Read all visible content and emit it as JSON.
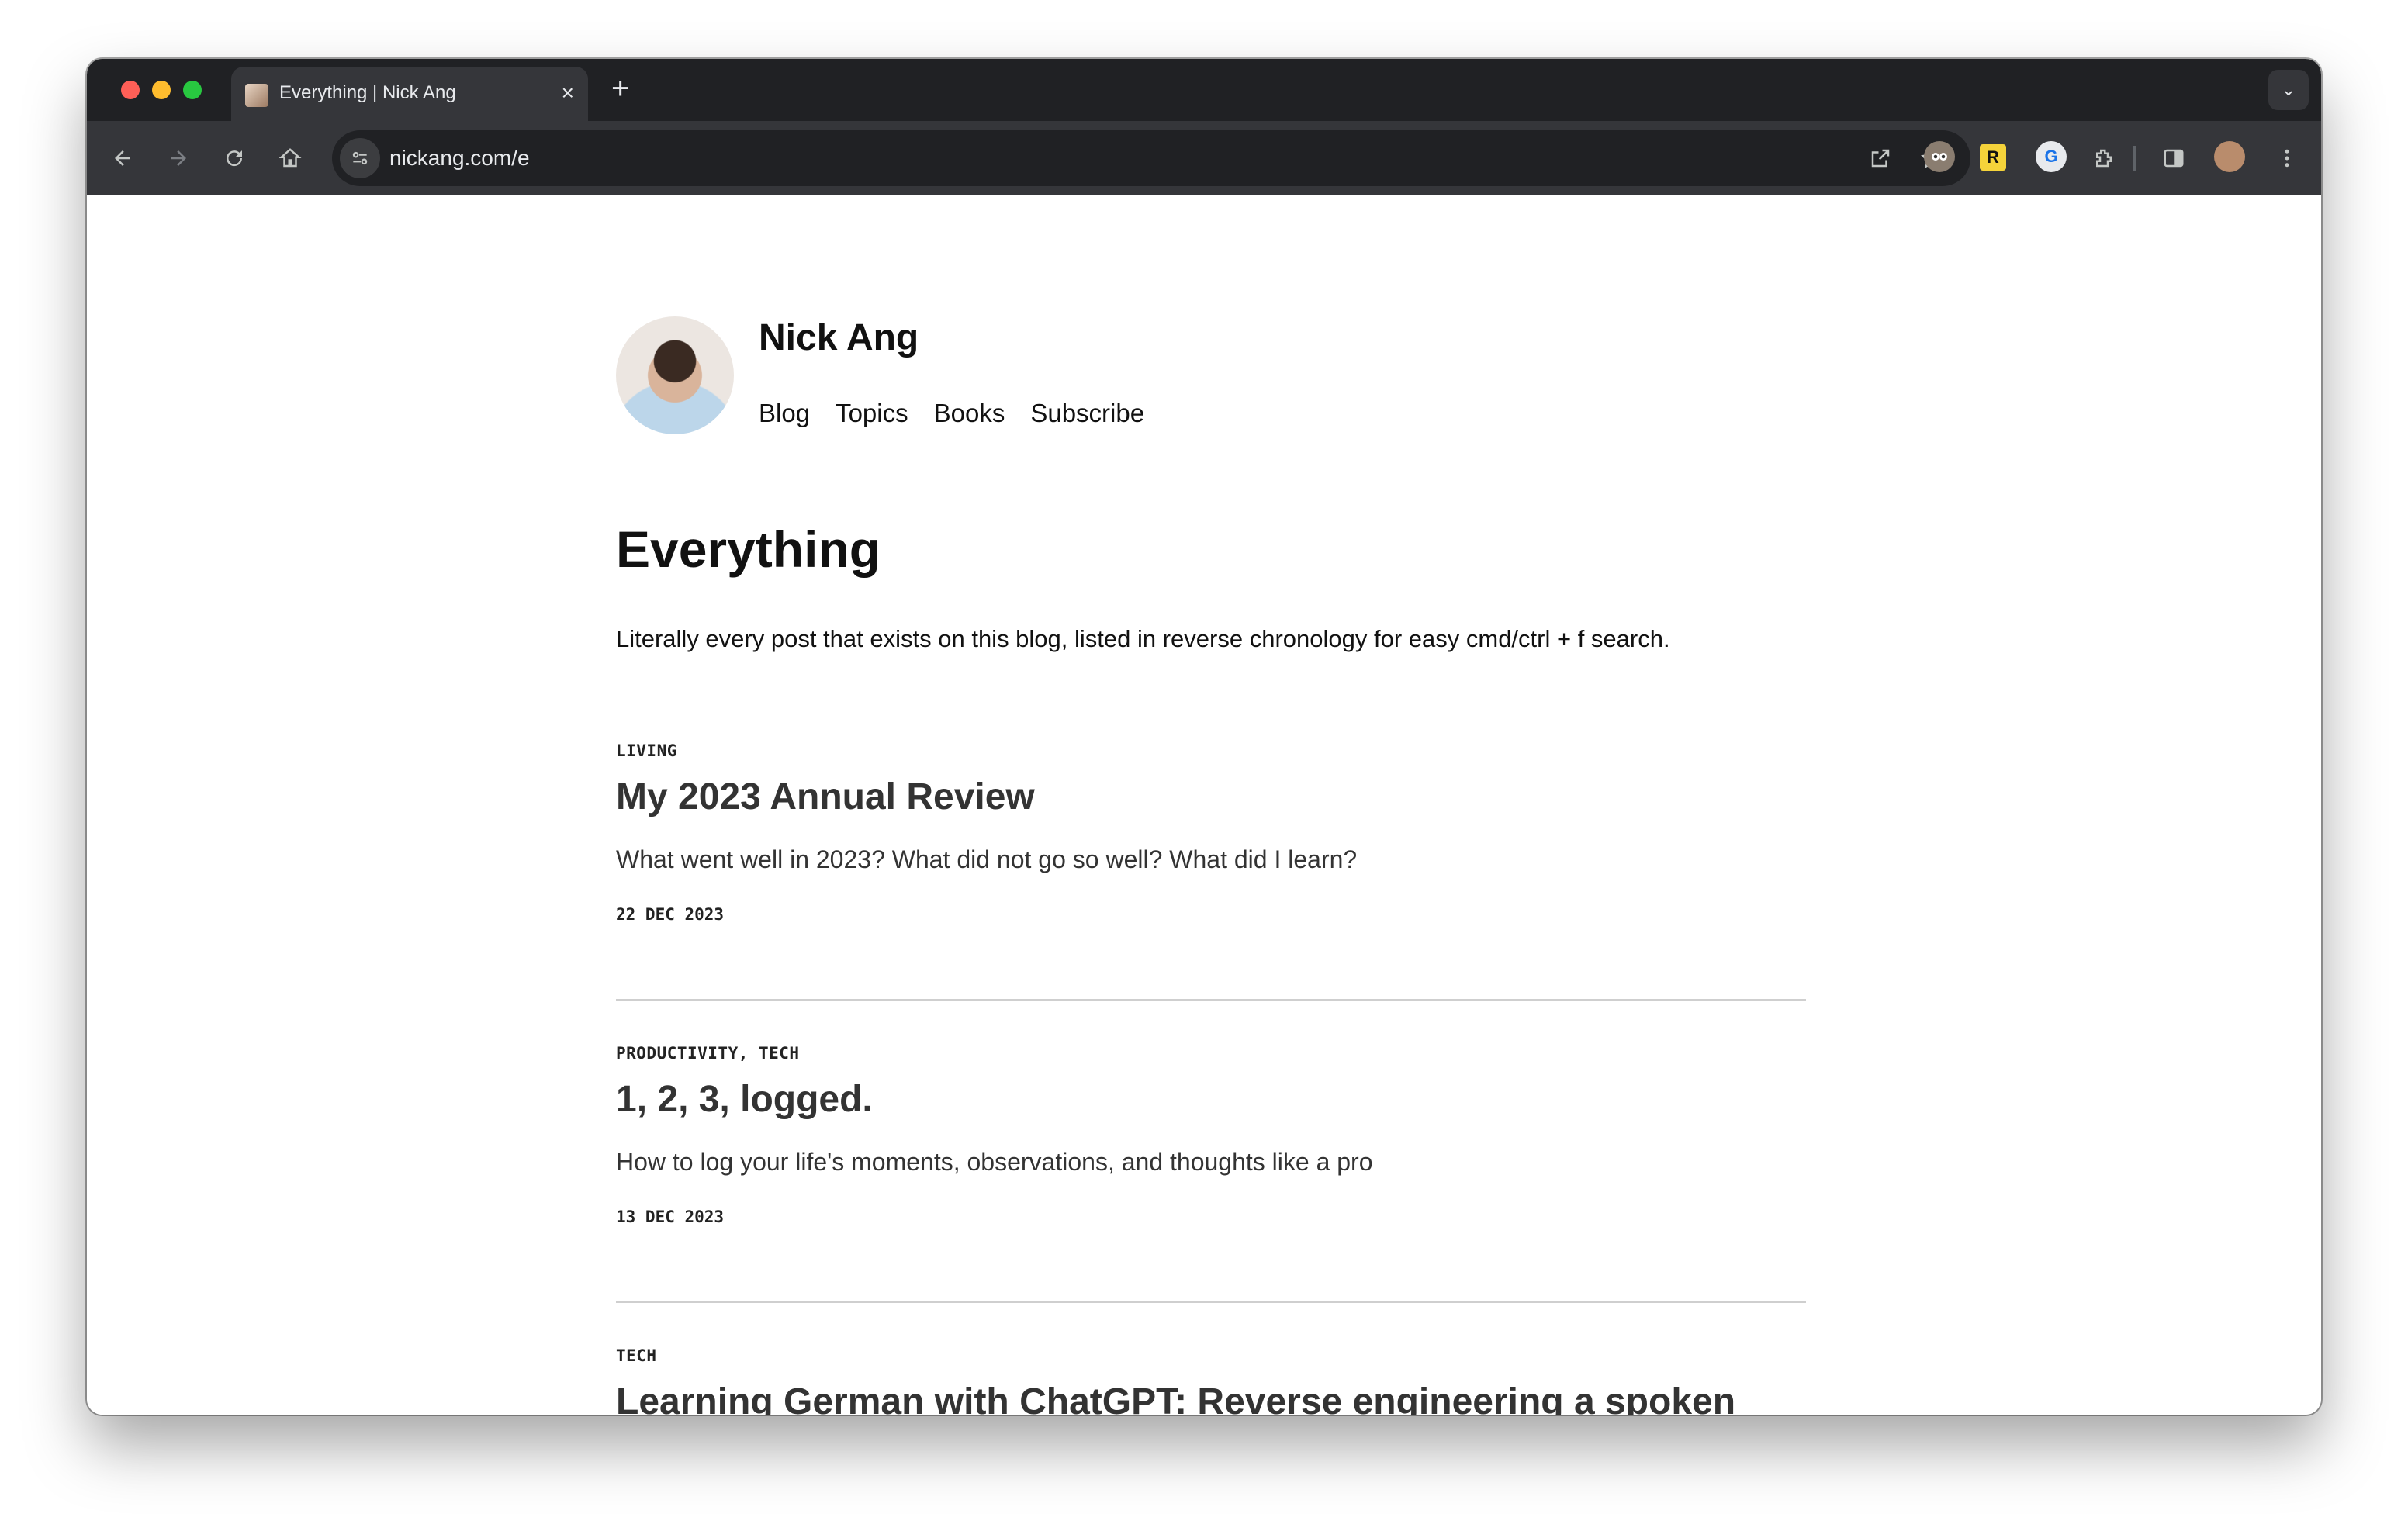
{
  "browser": {
    "tab_title": "Everything | Nick Ang",
    "tab_close": "×",
    "new_tab": "+",
    "url": "nickang.com/e",
    "tab_dropdown": "⌄"
  },
  "site": {
    "name": "Nick Ang",
    "nav": [
      "Blog",
      "Topics",
      "Books",
      "Subscribe"
    ]
  },
  "main": {
    "title": "Everything",
    "intro": "Literally every post that exists on this blog, listed in reverse chronology for easy cmd/ctrl + f search.",
    "posts": [
      {
        "tags": "LIVING",
        "title": "My 2023 Annual Review",
        "description": "What went well in 2023? What did not go so well? What did I learn?",
        "date": "22 DEC 2023"
      },
      {
        "tags": "PRODUCTIVITY, TECH",
        "title": "1, 2, 3, logged.",
        "description": "How to log your life's moments, observations, and thoughts like a pro",
        "date": "13 DEC 2023"
      },
      {
        "tags": "TECH",
        "title": "Learning German with ChatGPT: Reverse engineering a spoken sentence",
        "description": "",
        "date": ""
      }
    ]
  }
}
